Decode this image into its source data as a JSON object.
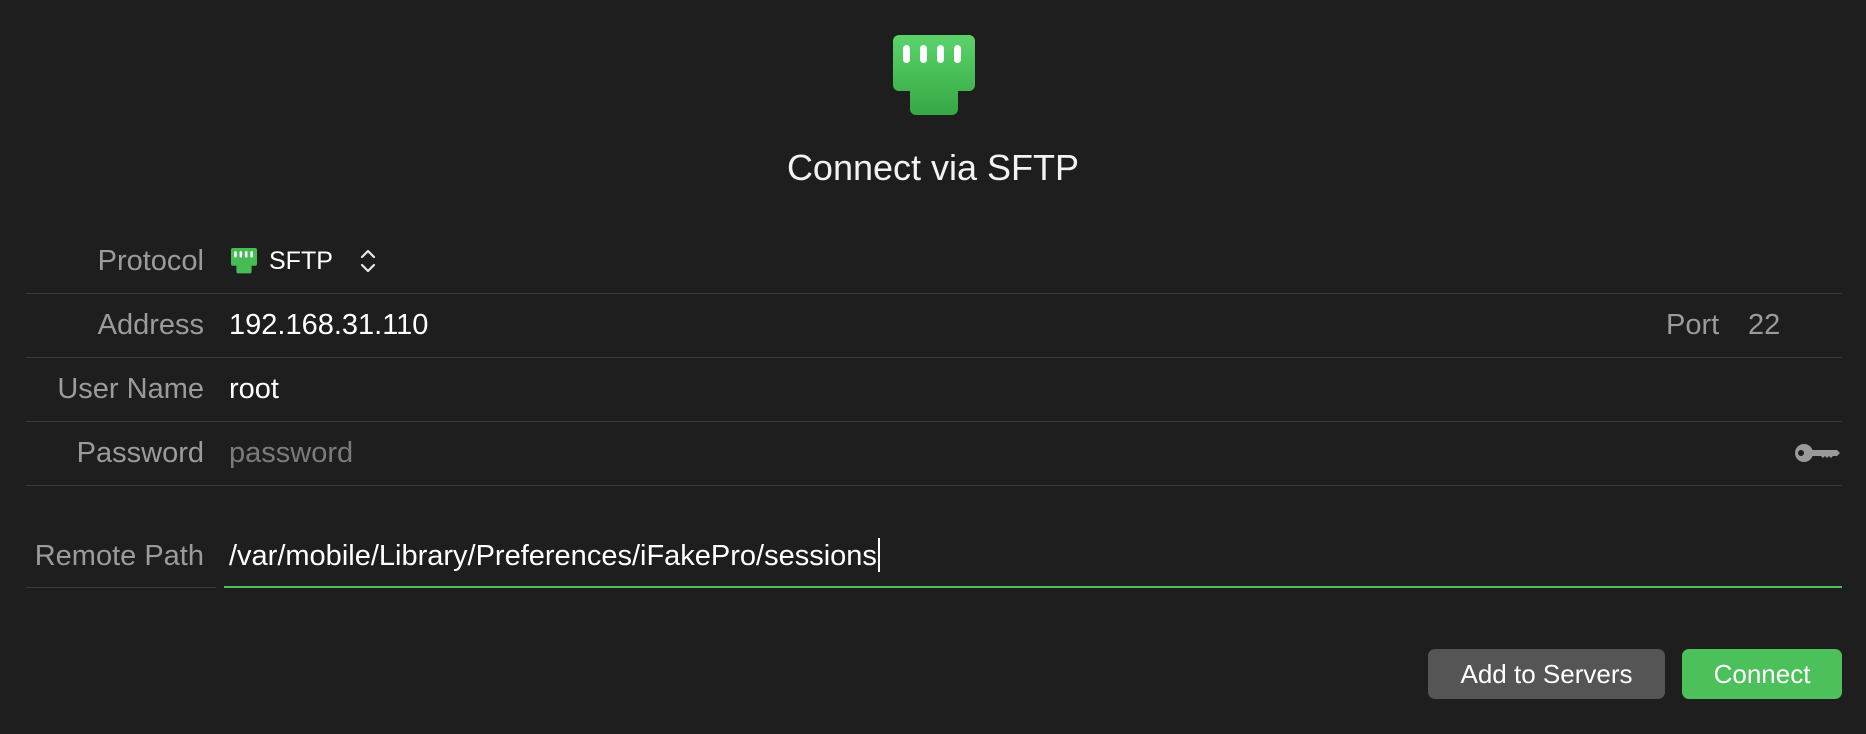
{
  "title": "Connect via SFTP",
  "protocol": {
    "label": "Protocol",
    "value": "SFTP",
    "icon": "ethernet-port-icon"
  },
  "address": {
    "label": "Address",
    "value": "192.168.31.110",
    "port_label": "Port",
    "port_value": "22"
  },
  "username": {
    "label": "User Name",
    "value": "root"
  },
  "password": {
    "label": "Password",
    "placeholder": "password",
    "icon": "key-icon"
  },
  "remote_path": {
    "label": "Remote Path",
    "value": "/var/mobile/Library/Preferences/iFakePro/sessions"
  },
  "buttons": {
    "add_to_servers": "Add to Servers",
    "connect": "Connect"
  },
  "colors": {
    "background": "#1e1e1e",
    "accent": "#4cc05a",
    "secondary_button": "#555555",
    "label": "#9b9b9b"
  }
}
